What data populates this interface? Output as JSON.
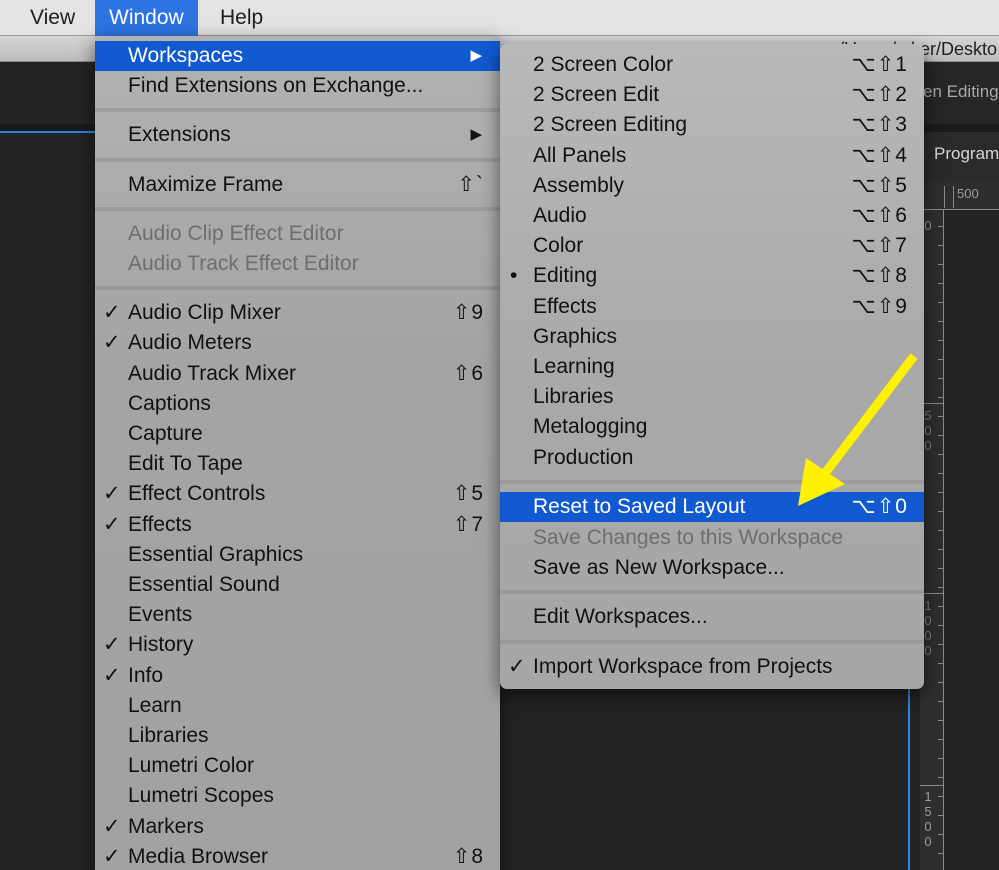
{
  "menubar": {
    "items": [
      {
        "label": "View",
        "active": false
      },
      {
        "label": "Window",
        "active": true
      },
      {
        "label": "Help",
        "active": false
      }
    ]
  },
  "background": {
    "path_fragment": "/Users/...ker/Deskto",
    "workspace_label": "en Editing",
    "panel_label": "Program",
    "ruler_top_label": "500",
    "ruler_left_labels": [
      "0",
      "500",
      "1000",
      "1500"
    ]
  },
  "window_menu": {
    "items": [
      {
        "label": "Workspaces",
        "submenu": true,
        "highlight": true
      },
      {
        "label": "Find Extensions on Exchange..."
      },
      {
        "separator": true
      },
      {
        "label": "Extensions",
        "submenu": true
      },
      {
        "separator": true
      },
      {
        "label": "Maximize Frame",
        "shortcut": "⇧`"
      },
      {
        "separator": true
      },
      {
        "label": "Audio Clip Effect Editor",
        "disabled": true
      },
      {
        "label": "Audio Track Effect Editor",
        "disabled": true
      },
      {
        "separator": true
      },
      {
        "label": "Audio Clip Mixer",
        "checked": true,
        "shortcut": "⇧9"
      },
      {
        "label": "Audio Meters",
        "checked": true
      },
      {
        "label": "Audio Track Mixer",
        "shortcut": "⇧6"
      },
      {
        "label": "Captions"
      },
      {
        "label": "Capture"
      },
      {
        "label": "Edit To Tape"
      },
      {
        "label": "Effect Controls",
        "checked": true,
        "shortcut": "⇧5"
      },
      {
        "label": "Effects",
        "checked": true,
        "shortcut": "⇧7"
      },
      {
        "label": "Essential Graphics"
      },
      {
        "label": "Essential Sound"
      },
      {
        "label": "Events"
      },
      {
        "label": "History",
        "checked": true
      },
      {
        "label": "Info",
        "checked": true
      },
      {
        "label": "Learn"
      },
      {
        "label": "Libraries"
      },
      {
        "label": "Lumetri Color"
      },
      {
        "label": "Lumetri Scopes"
      },
      {
        "label": "Markers",
        "checked": true
      },
      {
        "label": "Media Browser",
        "checked": true,
        "shortcut": "⇧8"
      }
    ]
  },
  "workspaces_menu": {
    "items": [
      {
        "label": "2 Screen Color",
        "shortcut": "⌥⇧1"
      },
      {
        "label": "2 Screen Edit",
        "shortcut": "⌥⇧2"
      },
      {
        "label": "2 Screen Editing",
        "shortcut": "⌥⇧3"
      },
      {
        "label": "All Panels",
        "shortcut": "⌥⇧4"
      },
      {
        "label": "Assembly",
        "shortcut": "⌥⇧5"
      },
      {
        "label": "Audio",
        "shortcut": "⌥⇧6"
      },
      {
        "label": "Color",
        "shortcut": "⌥⇧7"
      },
      {
        "label": "Editing",
        "shortcut": "⌥⇧8",
        "current": true
      },
      {
        "label": "Effects",
        "shortcut": "⌥⇧9"
      },
      {
        "label": "Graphics"
      },
      {
        "label": "Learning"
      },
      {
        "label": "Libraries"
      },
      {
        "label": "Metalogging"
      },
      {
        "label": "Production"
      },
      {
        "separator": true
      },
      {
        "label": "Reset to Saved Layout",
        "shortcut": "⌥⇧0",
        "highlight": true
      },
      {
        "label": "Save Changes to this Workspace",
        "disabled": true
      },
      {
        "label": "Save as New Workspace..."
      },
      {
        "separator": true
      },
      {
        "label": "Edit Workspaces..."
      },
      {
        "separator": true
      },
      {
        "label": "Import Workspace from Projects",
        "checked": true
      }
    ]
  },
  "icons": {
    "checkmark": "✓",
    "bullet": "•",
    "submenu_arrow": "▶"
  },
  "annotation": {
    "type": "arrow",
    "color": "#fff200",
    "points_to": "Reset to Saved Layout"
  }
}
